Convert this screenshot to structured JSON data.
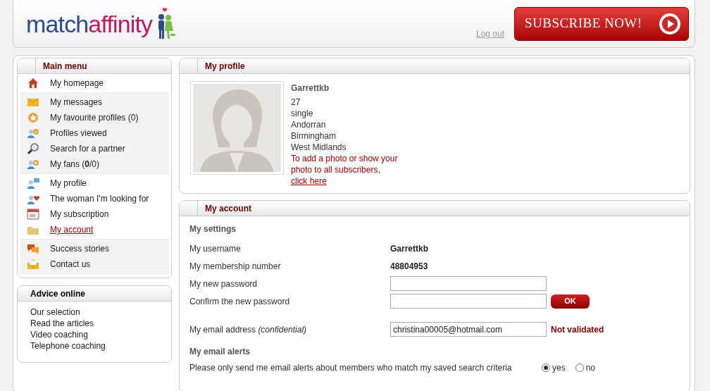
{
  "header": {
    "logo_part_1": "match",
    "logo_part_2": "affinity",
    "logout": "Log out",
    "subscribe": "SUBSCRIBE NOW!"
  },
  "main_menu": {
    "title": "Main menu",
    "groups": [
      {
        "shaded": false,
        "items": [
          {
            "label": "My homepage",
            "selected": false
          }
        ]
      },
      {
        "shaded": true,
        "items": [
          {
            "label": "My messages",
            "selected": false
          },
          {
            "label": "My favourite profiles (0)",
            "selected": false
          },
          {
            "label": "Profiles viewed",
            "selected": false
          },
          {
            "label": "Search for a partner",
            "selected": false
          },
          {
            "label": "My fans (**0**/0)",
            "selected": false
          }
        ]
      },
      {
        "shaded": false,
        "items": [
          {
            "label": "My profile",
            "selected": false
          },
          {
            "label": "The woman I'm looking for",
            "selected": false
          },
          {
            "label": "My subscription",
            "selected": false
          },
          {
            "label": "My account",
            "selected": true
          }
        ]
      },
      {
        "shaded": true,
        "items": [
          {
            "label": "Success stories",
            "selected": false
          },
          {
            "label": "Contact us",
            "selected": false
          }
        ]
      }
    ]
  },
  "advice": {
    "title": "Advice online",
    "items": [
      "Our selection",
      "Read the articles",
      "Video coaching",
      "Telephone coaching"
    ]
  },
  "profile": {
    "title": "My profile",
    "username": "Garrettkb",
    "details": [
      "27",
      "single",
      "Andorran",
      "Birmingham",
      "West Midlands"
    ],
    "notice": "To add a photo or show your photo to all subscribers,",
    "link": "click here"
  },
  "account": {
    "title": "My account",
    "settings_heading": "My settings",
    "rows": [
      {
        "kind": "text",
        "label": "My username",
        "value": "Garrettkb"
      },
      {
        "kind": "text",
        "label": "My membership number",
        "value": "48804953"
      },
      {
        "kind": "input",
        "label": "My new password"
      },
      {
        "kind": "input",
        "label": "Confirm the new password",
        "button": "OK"
      },
      {
        "kind": "input",
        "label": "My email address *(confidential)*",
        "value": "christina00005@hotmail.com",
        "status": "Not validated"
      }
    ],
    "alerts_heading": "My email alerts",
    "alert": {
      "question": "Please only send me email alerts about members who match my saved search criteria",
      "options": [
        {
          "label": "yes",
          "selected": true
        },
        {
          "label": "no",
          "selected": false
        }
      ]
    }
  }
}
